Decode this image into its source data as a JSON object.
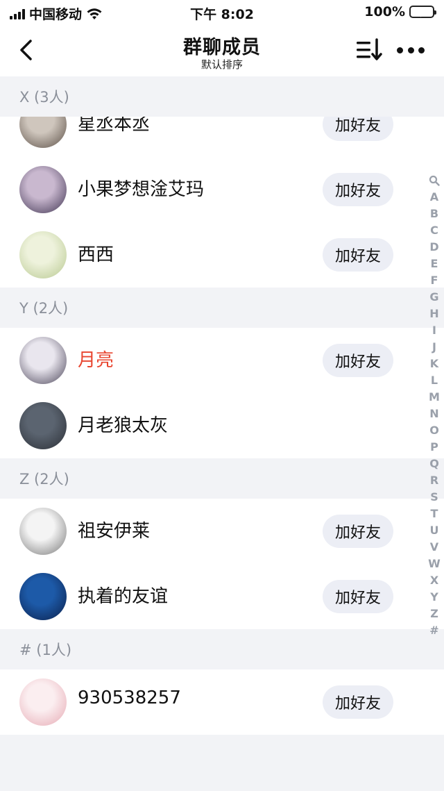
{
  "status_bar": {
    "carrier": "中国移动",
    "time": "下午 8:02",
    "battery_pct": "100%"
  },
  "nav": {
    "title": "群聊成员",
    "subtitle": "默认排序",
    "back_icon": "chevron-left-icon",
    "sort_icon": "sort-icon",
    "more_icon": "more-dots-icon"
  },
  "sections": [
    {
      "header": "X (3人)",
      "members": [
        {
          "name": "星丞本丞",
          "add_label": "加好友",
          "avatar_colors": [
            "#cfc6bd",
            "#5a4e45"
          ]
        },
        {
          "name": "小果梦想淦艾玛",
          "add_label": "加好友",
          "avatar_colors": [
            "#c9b8cf",
            "#3e3350"
          ]
        },
        {
          "name": "西西",
          "add_label": "加好友",
          "avatar_colors": [
            "#eef2dc",
            "#b7c88f"
          ]
        }
      ]
    },
    {
      "header": "Y (2人)",
      "members": [
        {
          "name": "月亮",
          "add_label": "加好友",
          "highlight": "#e8452f",
          "avatar_colors": [
            "#e9e6ee",
            "#4a4458"
          ]
        },
        {
          "name": "月老狼太灰",
          "add_label": "",
          "avatar_colors": [
            "#5b6470",
            "#2b2f36"
          ]
        }
      ]
    },
    {
      "header": "Z (2人)",
      "members": [
        {
          "name": "祖安伊莱",
          "add_label": "加好友",
          "avatar_colors": [
            "#f4f4f4",
            "#777777"
          ]
        },
        {
          "name": "执着的友谊",
          "add_label": "加好友",
          "avatar_colors": [
            "#1d5aa8",
            "#0b1f4a"
          ]
        }
      ]
    },
    {
      "header": "# (1人)",
      "members": [
        {
          "name": "930538257",
          "add_label": "加好友",
          "avatar_colors": [
            "#fbeef0",
            "#e6a9b3"
          ]
        }
      ]
    }
  ],
  "index_letters": [
    "A",
    "B",
    "C",
    "D",
    "E",
    "F",
    "G",
    "H",
    "I",
    "J",
    "K",
    "L",
    "M",
    "N",
    "O",
    "P",
    "Q",
    "R",
    "S",
    "T",
    "U",
    "V",
    "W",
    "X",
    "Y",
    "Z",
    "#"
  ]
}
